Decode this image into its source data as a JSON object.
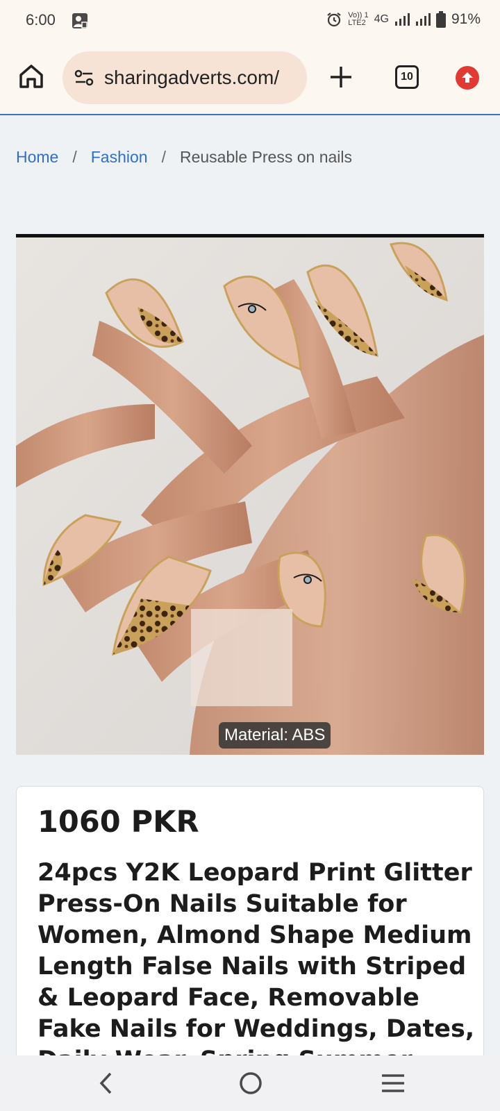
{
  "status_bar": {
    "time": "6:00",
    "network_small_top": "Vo)) 1",
    "network_small_bottom": "LTE2",
    "network_type": "4G",
    "battery_pct": "91%"
  },
  "browser": {
    "url": "sharingadverts.com/",
    "tab_count": "10",
    "accent": "#3874c5"
  },
  "breadcrumb": {
    "home": "Home",
    "category": "Fashion",
    "current": "Reusable Press on nails",
    "separator": "/"
  },
  "product": {
    "image_caption": "Material: ABS",
    "price": "1060 PKR",
    "title": "24pcs Y2K Leopard Print Glitter Press-On Nails Suitable for Women, Almond Shape Medium Length False Nails with Striped & Leopard Face, Removable Fake Nails for Weddings, Dates, Daily Wear, Spring Summer"
  },
  "icons": {
    "home": "home-icon",
    "site_settings": "site-settings-icon",
    "new_tab": "plus-icon",
    "tabs": "tab-switcher-icon",
    "update": "update-arrow-icon",
    "back": "back-chevron-icon",
    "home_nav": "home-circle-icon",
    "recents": "recents-menu-icon"
  }
}
